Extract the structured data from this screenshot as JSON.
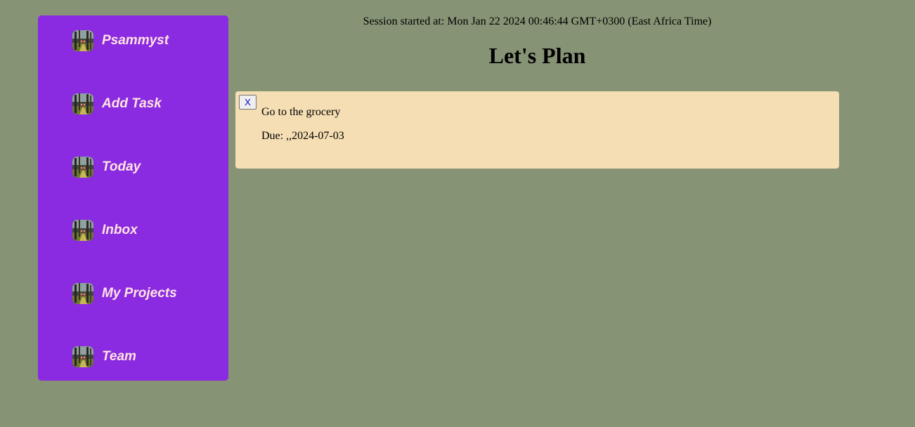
{
  "sidebar": {
    "items": [
      {
        "label": "Psammyst",
        "icon": "forest-avatar-icon"
      },
      {
        "label": "Add Task",
        "icon": "forest-avatar-icon"
      },
      {
        "label": "Today",
        "icon": "forest-avatar-icon"
      },
      {
        "label": "Inbox",
        "icon": "forest-avatar-icon"
      },
      {
        "label": "My Projects",
        "icon": "forest-avatar-icon"
      },
      {
        "label": "Team",
        "icon": "forest-avatar-icon"
      }
    ]
  },
  "header": {
    "session": "Session started at: Mon Jan 22 2024 00:46:44 GMT+0300 (East Africa Time)",
    "title": "Let's Plan"
  },
  "tasks": [
    {
      "close_label": "X",
      "title": "Go to the grocery",
      "due": "Due: ,,2024-07-03"
    }
  ],
  "colors": {
    "page_background": "#879375",
    "sidebar_background": "#8a2be2",
    "sidebar_text": "#ffe4e1",
    "task_card_background": "#f5deb3"
  }
}
